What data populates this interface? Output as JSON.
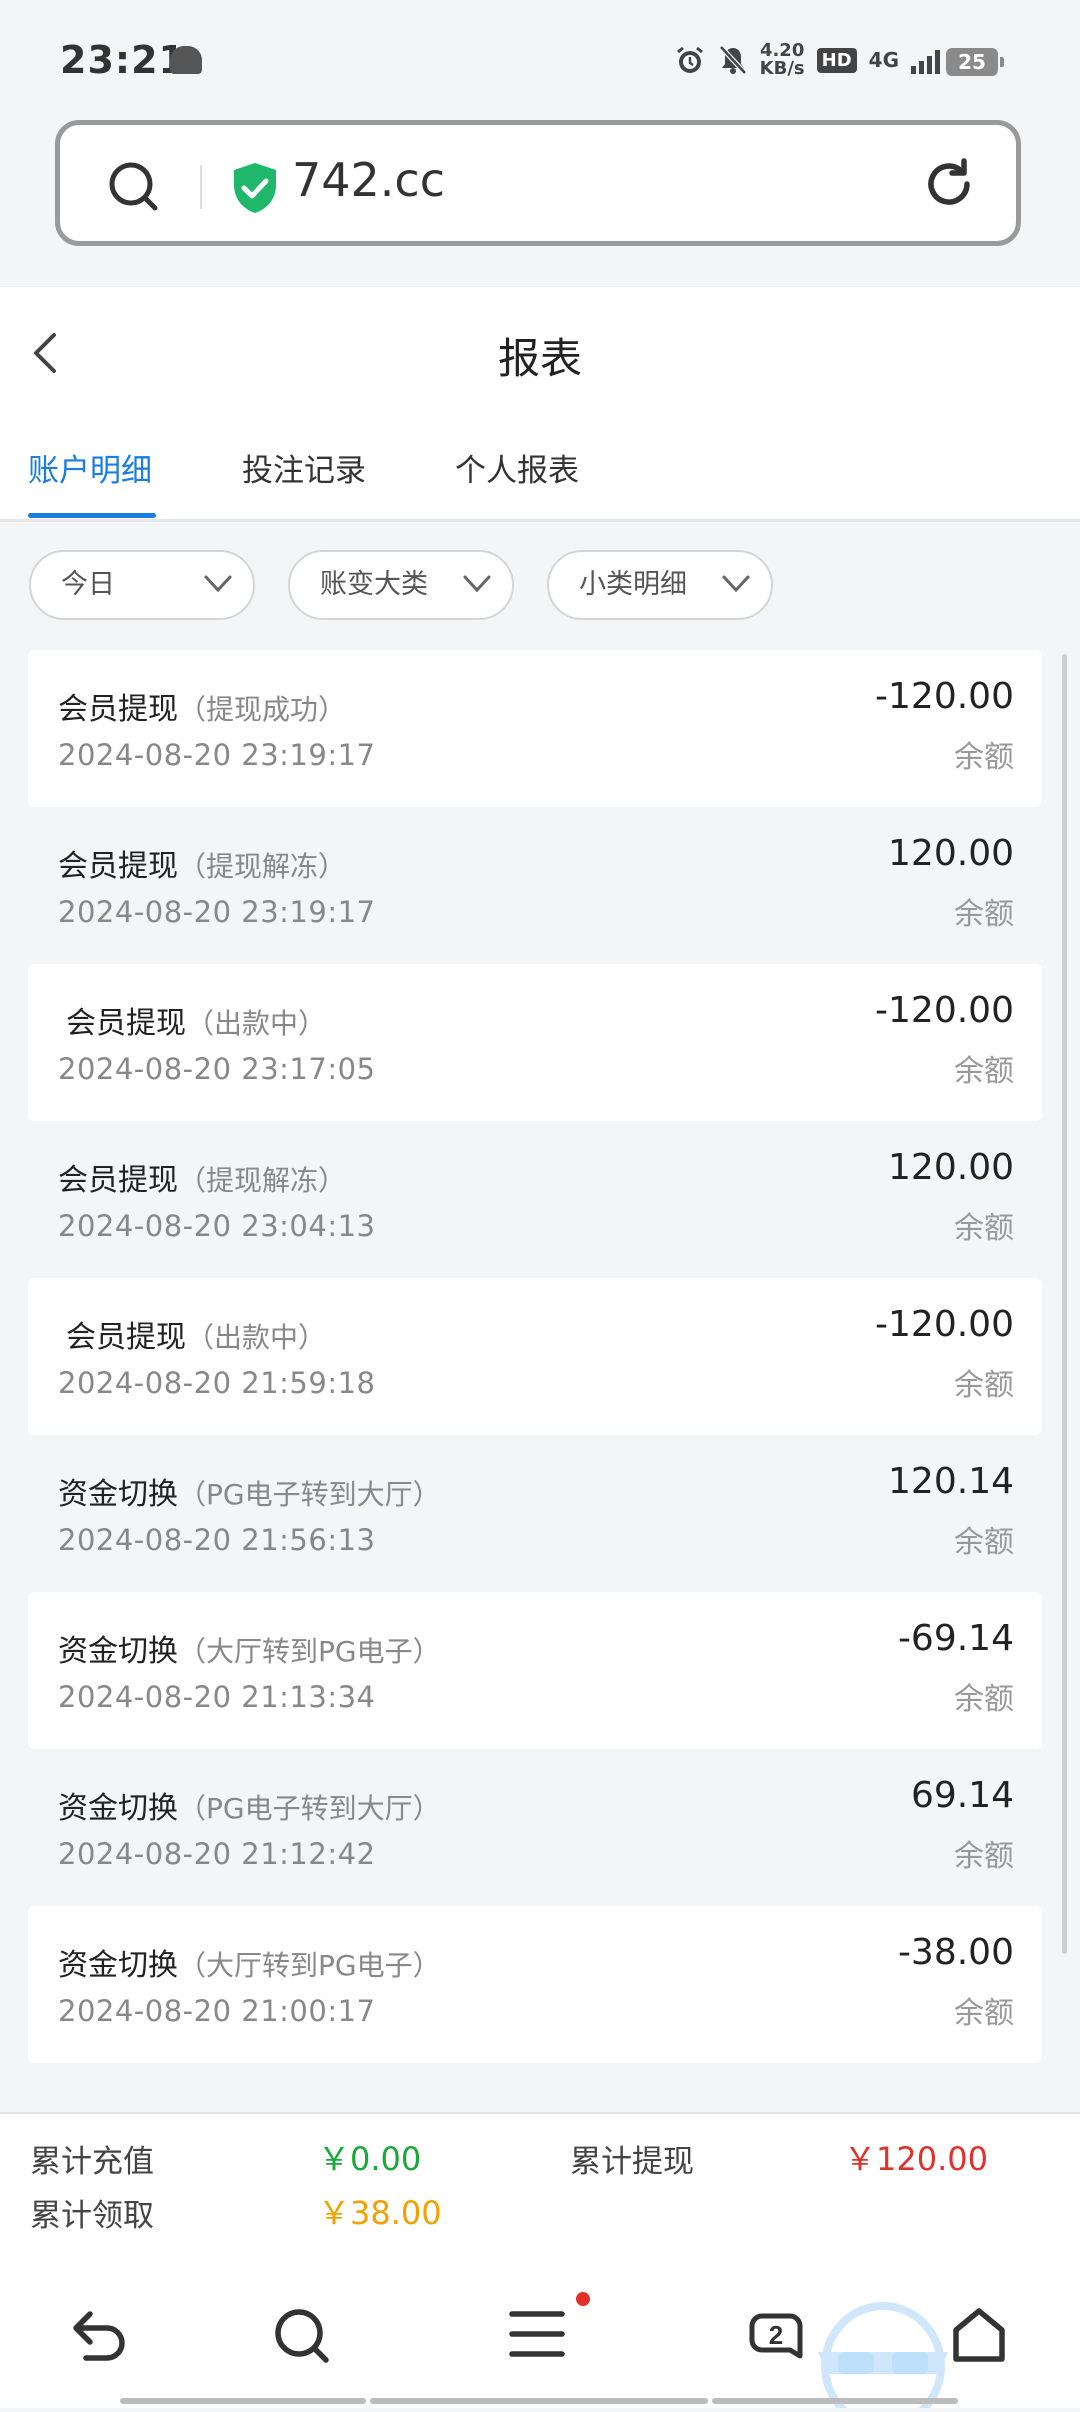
{
  "status_bar": {
    "time": "23:21",
    "net_speed": "4.20",
    "net_unit": "KB/s",
    "hd": "HD",
    "network": "4G",
    "battery": "25"
  },
  "browser": {
    "url": "742.cc"
  },
  "header": {
    "title": "报表"
  },
  "tabs": [
    "账户明细",
    "投注记录",
    "个人报表"
  ],
  "filters": [
    "今日",
    "账变大类",
    "小类明细"
  ],
  "records": [
    {
      "name": "会员提现",
      "detail": "（提现成功）",
      "time": "2024-08-20 23:19:17",
      "amount": "-120.00",
      "balance_label": "余额"
    },
    {
      "name": "会员提现",
      "detail": "（提现解冻）",
      "time": "2024-08-20 23:19:17",
      "amount": "120.00",
      "balance_label": "余额"
    },
    {
      "name": "会员提现",
      "detail": "（出款中）",
      "time": "2024-08-20 23:17:05",
      "amount": "-120.00",
      "balance_label": "余额"
    },
    {
      "name": "会员提现",
      "detail": "（提现解冻）",
      "time": "2024-08-20 23:04:13",
      "amount": "120.00",
      "balance_label": "余额"
    },
    {
      "name": "会员提现",
      "detail": "（出款中）",
      "time": "2024-08-20 21:59:18",
      "amount": "-120.00",
      "balance_label": "余额"
    },
    {
      "name": "资金切换",
      "detail": "（PG电子转到大厅）",
      "time": "2024-08-20 21:56:13",
      "amount": "120.14",
      "balance_label": "余额"
    },
    {
      "name": "资金切换",
      "detail": "（大厅转到PG电子）",
      "time": "2024-08-20 21:13:34",
      "amount": "-69.14",
      "balance_label": "余额"
    },
    {
      "name": "资金切换",
      "detail": "（PG电子转到大厅）",
      "time": "2024-08-20 21:12:42",
      "amount": "69.14",
      "balance_label": "余额"
    },
    {
      "name": "资金切换",
      "detail": "（大厅转到PG电子）",
      "time": "2024-08-20 21:00:17",
      "amount": "-38.00",
      "balance_label": "余额"
    }
  ],
  "summary": {
    "recharge_label": "累计充值",
    "recharge_value": "￥0.00",
    "withdraw_label": "累计提现",
    "withdraw_value": "￥120.00",
    "claim_label": "累计领取",
    "claim_value": "￥38.00"
  },
  "nav": {
    "tabs_count": "2"
  },
  "colors": {
    "accent": "#1a7de0",
    "green": "#1aa83a",
    "red": "#e0312b",
    "gold": "#f2a100"
  }
}
